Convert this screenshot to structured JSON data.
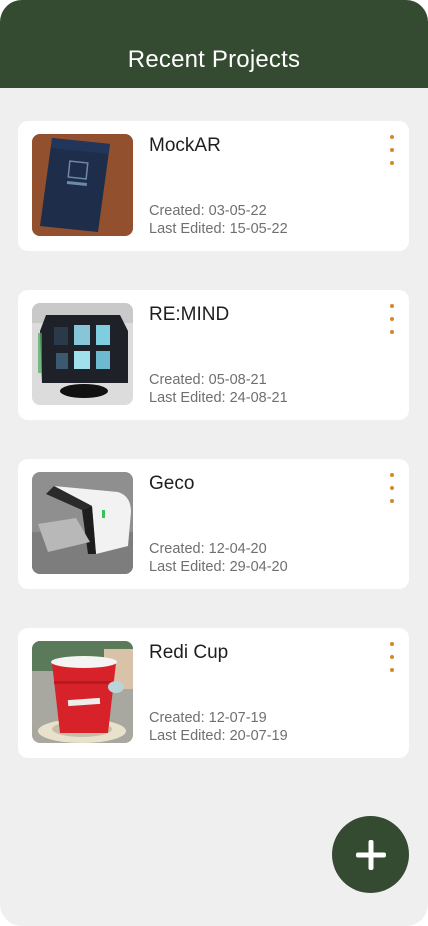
{
  "header": {
    "title": "Recent Projects"
  },
  "projects": [
    {
      "name": "MockAR",
      "created": "Created: 03-05-22",
      "edited": "Last Edited: 15-05-22"
    },
    {
      "name": "RE:MIND",
      "created": "Created: 05-08-21",
      "edited": "Last Edited: 24-08-21"
    },
    {
      "name": "Geco",
      "created": "Created: 12-04-20",
      "edited": "Last Edited: 29-04-20"
    },
    {
      "name": "Redi Cup",
      "created": "Created: 12-07-19",
      "edited": "Last Edited: 20-07-19"
    }
  ],
  "icons": {
    "card_menu": "more-vertical-icon",
    "fab": "plus-icon"
  },
  "colors": {
    "header": "#344a31",
    "accent": "#d4882b",
    "background": "#efefef"
  }
}
